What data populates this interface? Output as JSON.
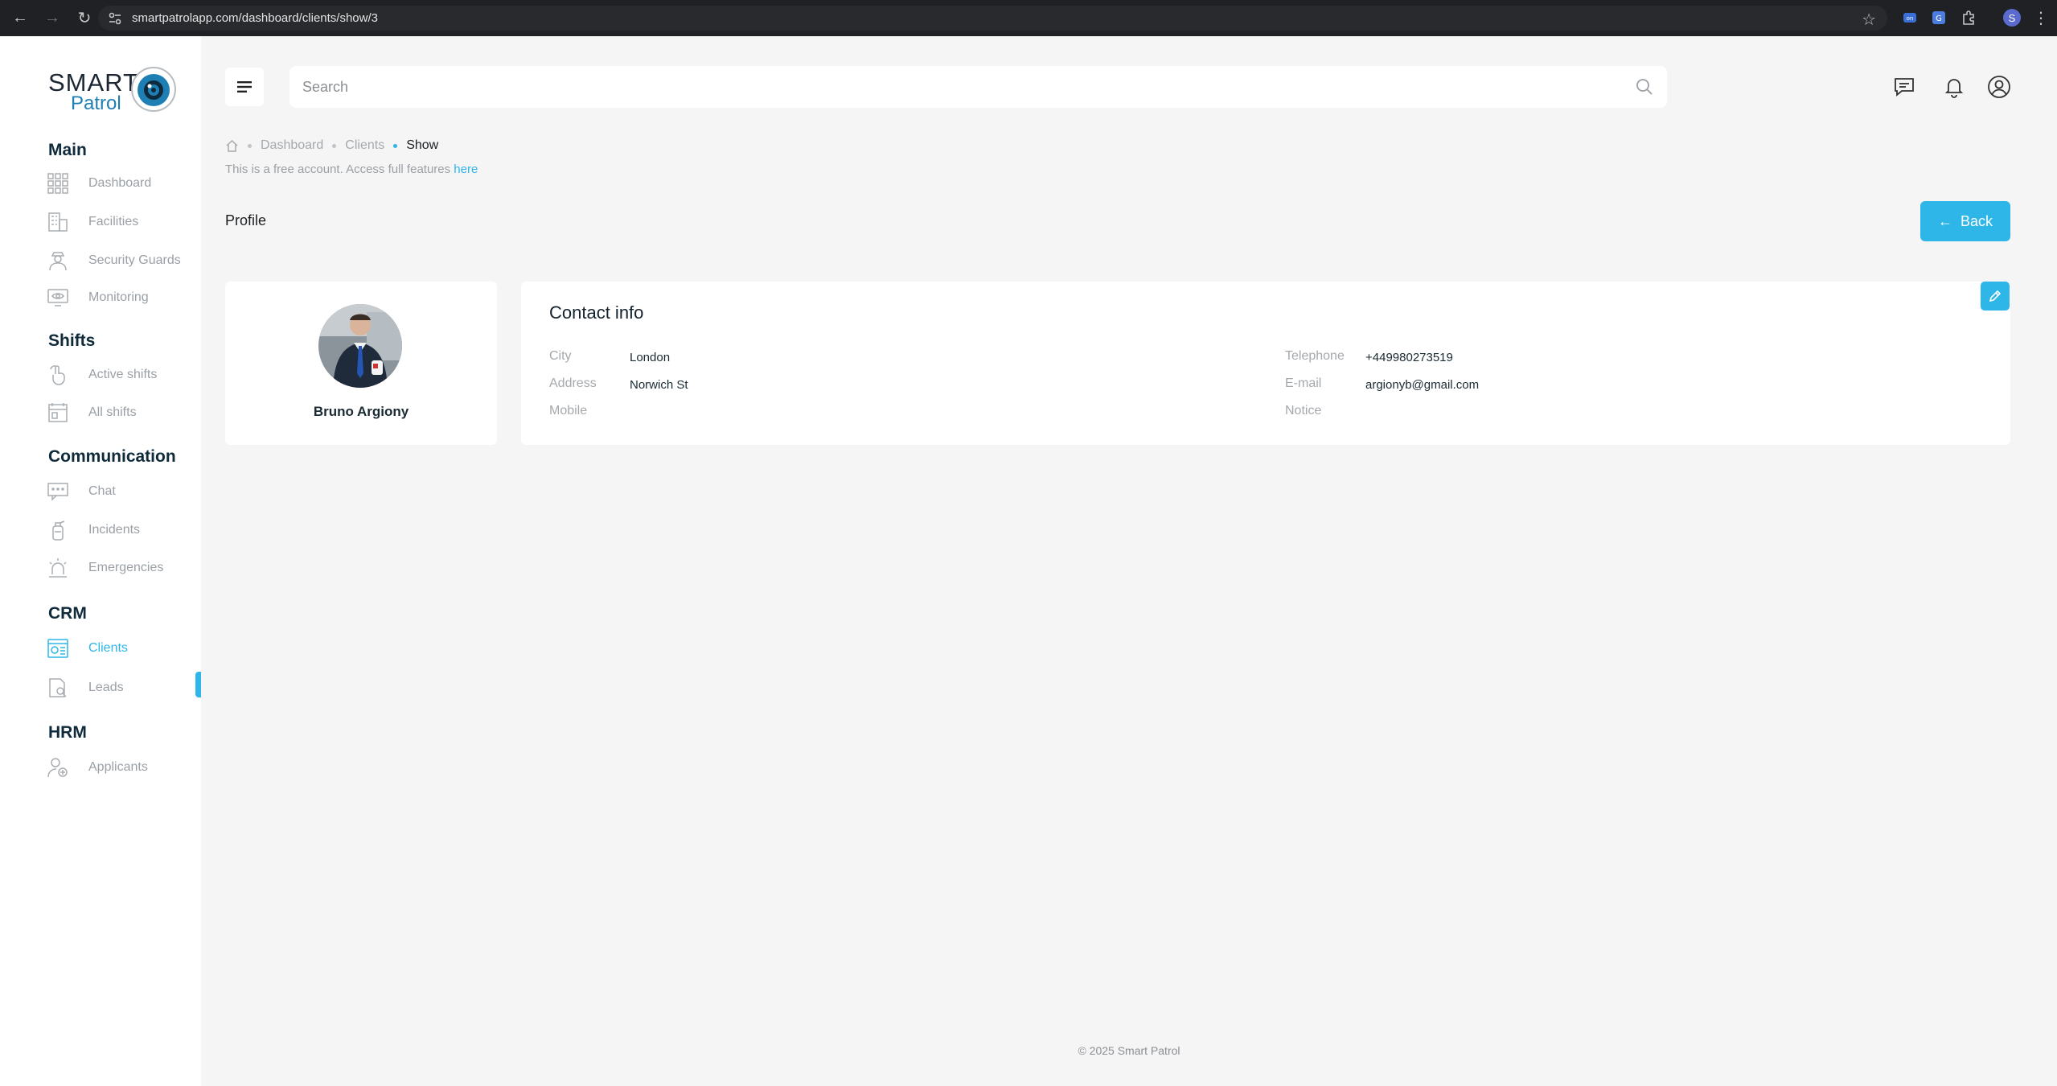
{
  "browser": {
    "url": "smartpatrolapp.com/dashboard/clients/show/3",
    "profile_initial": "S"
  },
  "logo": {
    "line1": "SMART",
    "line2": "Patrol"
  },
  "sidebar": {
    "sections": [
      {
        "title": "Main"
      },
      {
        "title": "Shifts"
      },
      {
        "title": "Communication"
      },
      {
        "title": "CRM"
      },
      {
        "title": "HRM"
      }
    ],
    "items": [
      {
        "label": "Dashboard",
        "icon": "grid-icon"
      },
      {
        "label": "Facilities",
        "icon": "building-icon"
      },
      {
        "label": "Security Guards",
        "icon": "guard-icon"
      },
      {
        "label": "Monitoring",
        "icon": "monitor-eye-icon"
      },
      {
        "label": "Active shifts",
        "icon": "hand-pointer-icon"
      },
      {
        "label": "All shifts",
        "icon": "calendar-list-icon"
      },
      {
        "label": "Chat",
        "icon": "chat-icon"
      },
      {
        "label": "Incidents",
        "icon": "fire-extinguisher-icon"
      },
      {
        "label": "Emergencies",
        "icon": "siren-icon"
      },
      {
        "label": "Clients",
        "icon": "clients-icon",
        "active": true
      },
      {
        "label": "Leads",
        "icon": "lead-document-icon"
      },
      {
        "label": "Applicants",
        "icon": "applicant-icon"
      }
    ]
  },
  "header": {
    "search_placeholder": "Search"
  },
  "breadcrumb": {
    "items": [
      "Dashboard",
      "Clients",
      "Show"
    ]
  },
  "notice": {
    "text": "This is a free account. Access full features ",
    "link": "here"
  },
  "page": {
    "title": "Profile",
    "back_label": "Back"
  },
  "profile": {
    "name": "Bruno Argiony"
  },
  "contact": {
    "title": "Contact info",
    "left": [
      {
        "label": "City",
        "value": "London"
      },
      {
        "label": "Address",
        "value": "Norwich St"
      },
      {
        "label": "Mobile",
        "value": ""
      }
    ],
    "right": [
      {
        "label": "Telephone",
        "value": "+449980273519"
      },
      {
        "label": "E-mail",
        "value": "argionyb@gmail.com"
      },
      {
        "label": "Notice",
        "value": ""
      }
    ]
  },
  "footer": {
    "text": "© 2025 Smart Patrol"
  },
  "colors": {
    "accent": "#2eb6e8",
    "sidebar_bg": "#ffffff",
    "page_bg": "#f5f5f5"
  }
}
